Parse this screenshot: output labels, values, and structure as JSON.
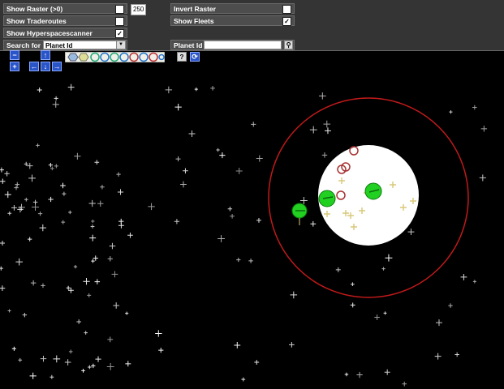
{
  "controls": {
    "show_raster": {
      "label": "Show Raster (>0)",
      "checked": false
    },
    "raster_value": "250",
    "show_traderoutes": {
      "label": "Show Traderoutes",
      "checked": false
    },
    "show_hyperspacescanner": {
      "label": "Show Hyperspacescanner",
      "checked": true
    },
    "search_for": {
      "label": "Search for",
      "value": "Planet Id"
    },
    "invert_raster": {
      "label": "Invert Raster",
      "checked": false
    },
    "show_fleets": {
      "label": "Show Fleets",
      "checked": true
    },
    "planet_id": {
      "label": "Planet Id :",
      "value": ""
    },
    "checked_mark": "✓"
  },
  "navigation": {
    "zoom_in": "+",
    "zoom_out": "−",
    "up": "↑",
    "down": "↓",
    "left": "←",
    "right": "→",
    "help": "?",
    "refresh": "⟳"
  },
  "colors": {
    "panel": "#343434",
    "stars": "#ffffff",
    "scan_circle": "#c21a1a",
    "planet_area": "#ffffff",
    "fleet": "#22d022",
    "enemy": "#a83232",
    "own": "#d8c878"
  }
}
